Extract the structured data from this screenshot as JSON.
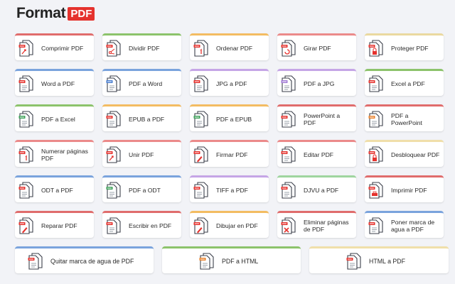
{
  "brand": {
    "word": "Format",
    "badge": "PDF"
  },
  "colors": {
    "brand_red": "#e5322d",
    "page_bg": "#f2f3f7"
  },
  "tools": [
    {
      "label": "Comprimir PDF",
      "accent": "c-red",
      "icon": "compress-pdf-icon",
      "badge": "#e5322d",
      "mark": "arrows"
    },
    {
      "label": "Dividir PDF",
      "accent": "c-green",
      "icon": "split-pdf-icon",
      "badge": "#e5322d",
      "mark": "scissors"
    },
    {
      "label": "Ordenar PDF",
      "accent": "c-orange",
      "icon": "organize-pdf-icon",
      "badge": "#e5322d",
      "mark": "number"
    },
    {
      "label": "Girar PDF",
      "accent": "c-pink",
      "icon": "rotate-pdf-icon",
      "badge": "#e5322d",
      "mark": "rotate"
    },
    {
      "label": "Proteger PDF",
      "accent": "c-yellow",
      "icon": "protect-pdf-icon",
      "badge": "#e5322d",
      "mark": "lock"
    },
    {
      "label": "Word a PDF",
      "accent": "c-blue",
      "icon": "word-to-pdf-icon",
      "badge": "#e5322d",
      "mark": "lines"
    },
    {
      "label": "PDF a Word",
      "accent": "c-blue",
      "icon": "pdf-to-word-icon",
      "badge": "#4a7fd0",
      "mark": "lines"
    },
    {
      "label": "JPG a PDF",
      "accent": "c-purple",
      "icon": "jpg-to-pdf-icon",
      "badge": "#e5322d",
      "mark": "lines"
    },
    {
      "label": "PDF a JPG",
      "accent": "c-purple",
      "icon": "pdf-to-jpg-icon",
      "badge": "#a27bd6",
      "mark": "lines"
    },
    {
      "label": "Excel a PDF",
      "accent": "c-green",
      "icon": "excel-to-pdf-icon",
      "badge": "#e5322d",
      "mark": "lines"
    },
    {
      "label": "PDF a Excel",
      "accent": "c-green",
      "icon": "pdf-to-excel-icon",
      "badge": "#3fa05a",
      "mark": "lines"
    },
    {
      "label": "EPUB a PDF",
      "accent": "c-orange",
      "icon": "epub-to-pdf-icon",
      "badge": "#e5322d",
      "mark": "lines"
    },
    {
      "label": "PDF a EPUB",
      "accent": "c-orange",
      "icon": "pdf-to-epub-icon",
      "badge": "#3fa05a",
      "mark": "lines"
    },
    {
      "label": "PowerPoint a PDF",
      "accent": "c-red",
      "icon": "powerpoint-to-pdf-icon",
      "badge": "#e5322d",
      "mark": "lines"
    },
    {
      "label": "PDF a PowerPoint",
      "accent": "c-red",
      "icon": "pdf-to-powerpoint-icon",
      "badge": "#e8822d",
      "mark": "lines"
    },
    {
      "label": "Numerar páginas PDF",
      "accent": "c-pink",
      "icon": "page-numbers-icon",
      "badge": "#e5322d",
      "mark": "number"
    },
    {
      "label": "Unir PDF",
      "accent": "c-pink",
      "icon": "merge-pdf-icon",
      "badge": "#e5322d",
      "mark": "arrows"
    },
    {
      "label": "Firmar PDF",
      "accent": "c-pink",
      "icon": "sign-pdf-icon",
      "badge": "#e5322d",
      "mark": "pen"
    },
    {
      "label": "Editar PDF",
      "accent": "c-pink",
      "icon": "edit-pdf-icon",
      "badge": "#e5322d",
      "mark": "lines"
    },
    {
      "label": "Desbloquear PDF",
      "accent": "c-beige",
      "icon": "unlock-pdf-icon",
      "badge": "#e5322d",
      "mark": "lock"
    },
    {
      "label": "ODT a PDF",
      "accent": "c-blue",
      "icon": "odt-to-pdf-icon",
      "badge": "#e5322d",
      "mark": "lines"
    },
    {
      "label": "PDF a ODT",
      "accent": "c-blue",
      "icon": "pdf-to-odt-icon",
      "badge": "#3fa05a",
      "mark": "lines"
    },
    {
      "label": "TIFF a PDF",
      "accent": "c-purple",
      "icon": "tiff-to-pdf-icon",
      "badge": "#e5322d",
      "mark": "lines"
    },
    {
      "label": "DJVU a PDF",
      "accent": "c-mint",
      "icon": "djvu-to-pdf-icon",
      "badge": "#e5322d",
      "mark": "lines"
    },
    {
      "label": "Imprimir PDF",
      "accent": "c-red",
      "icon": "print-pdf-icon",
      "badge": "#e5322d",
      "mark": "printer"
    },
    {
      "label": "Reparar PDF",
      "accent": "c-red",
      "icon": "repair-pdf-icon",
      "badge": "#e5322d",
      "mark": "pen"
    },
    {
      "label": "Escribir en PDF",
      "accent": "c-red",
      "icon": "write-pdf-icon",
      "badge": "#e5322d",
      "mark": "lines"
    },
    {
      "label": "Dibujar en PDF",
      "accent": "c-orange",
      "icon": "draw-pdf-icon",
      "badge": "#e5322d",
      "mark": "pen"
    },
    {
      "label": "Eliminar páginas de PDF",
      "accent": "c-red",
      "icon": "delete-pages-icon",
      "badge": "#e5322d",
      "mark": "cross"
    },
    {
      "label": "Poner marca de agua a PDF",
      "accent": "c-blue",
      "icon": "watermark-pdf-icon",
      "badge": "#e5322d",
      "mark": "lines"
    }
  ],
  "bottom_tools": [
    {
      "label": "Quitar marca de agua de PDF",
      "accent": "c-blue",
      "icon": "remove-watermark-icon",
      "badge": "#e5322d",
      "mark": "lines"
    },
    {
      "label": "PDF a HTML",
      "accent": "c-green",
      "icon": "pdf-to-html-icon",
      "badge": "#e8822d",
      "mark": "lines"
    },
    {
      "label": "HTML a PDF",
      "accent": "c-beige",
      "icon": "html-to-pdf-icon",
      "badge": "#e5322d",
      "mark": "lines"
    }
  ]
}
